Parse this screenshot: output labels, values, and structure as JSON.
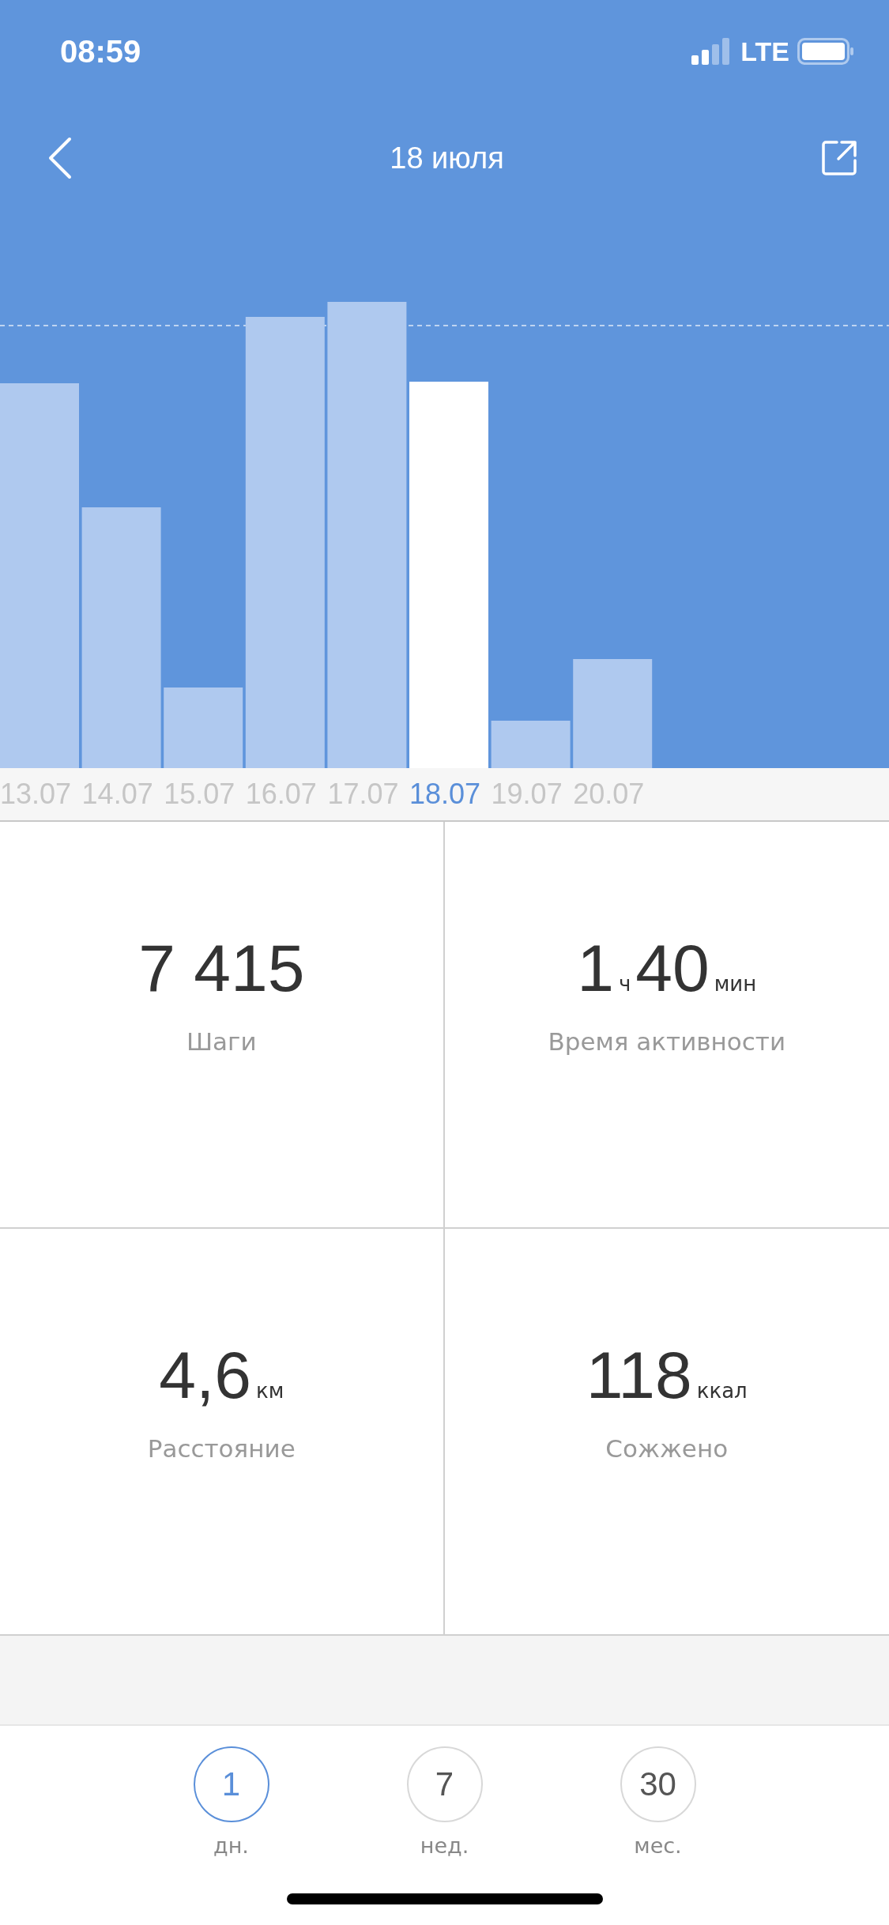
{
  "status_bar": {
    "time": "08:59",
    "network": "LTE"
  },
  "header": {
    "title": "18 июля"
  },
  "days": [
    {
      "label": "13.07",
      "selected": false
    },
    {
      "label": "14.07",
      "selected": false
    },
    {
      "label": "15.07",
      "selected": false
    },
    {
      "label": "16.07",
      "selected": false
    },
    {
      "label": "17.07",
      "selected": false
    },
    {
      "label": "18.07",
      "selected": true
    },
    {
      "label": "19.07",
      "selected": false
    },
    {
      "label": "20.07",
      "selected": false
    }
  ],
  "stats": [
    {
      "parts": [
        {
          "kind": "value",
          "text": "7 415"
        }
      ],
      "label": "Шаги"
    },
    {
      "parts": [
        {
          "kind": "value",
          "text": "1"
        },
        {
          "kind": "unit",
          "text": "ч"
        },
        {
          "kind": "value",
          "text": "40"
        },
        {
          "kind": "unit",
          "text": "мин"
        }
      ],
      "label": "Время активности"
    },
    {
      "parts": [
        {
          "kind": "value",
          "text": "4,6"
        },
        {
          "kind": "unit",
          "text": "км"
        }
      ],
      "label": "Расстояние"
    },
    {
      "parts": [
        {
          "kind": "value",
          "text": "118"
        },
        {
          "kind": "unit",
          "text": "ккал"
        }
      ],
      "label": "Сожжено"
    }
  ],
  "periods": [
    {
      "number": "1",
      "label": "дн.",
      "selected": true
    },
    {
      "number": "7",
      "label": "нед.",
      "selected": false
    },
    {
      "number": "30",
      "label": "мес.",
      "selected": false
    }
  ]
}
